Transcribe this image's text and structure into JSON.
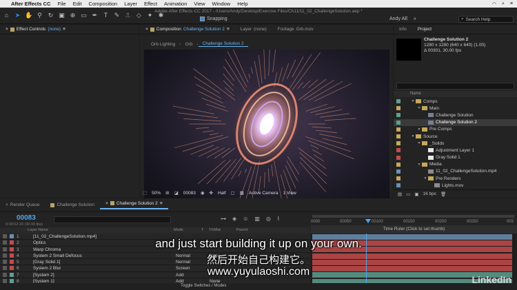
{
  "menubar": {
    "app": "After Effects CC",
    "items": [
      "File",
      "Edit",
      "Composition",
      "Layer",
      "Effect",
      "Animation",
      "View",
      "Window",
      "Help"
    ]
  },
  "toolbar": {
    "title": "Adobe After Effects CC 2017 - /Users/Andy/Desktop/Exercise Files/Ch11/11_02_ChallengeSolution.aep *",
    "snapping": "Snapping",
    "workspace_user": "Andy AE",
    "search_placeholder": "Search Help"
  },
  "effect_panel": {
    "tab_label": "Effect Controls",
    "tab_value": "(none)"
  },
  "comp_panel": {
    "tabs": [
      {
        "label": "Composition",
        "value": "Challenge Solution 2"
      },
      {
        "label": "Layer",
        "value": "(none)"
      },
      {
        "label": "Footage",
        "value": "Orb.mov"
      }
    ],
    "breadcrumbs": [
      "Orb Lighting",
      "Orb",
      "Challenge Solution 2"
    ],
    "viewer_bar": {
      "zoom": "50%",
      "timecode": "00083",
      "resolution": "Half",
      "camera": "Active Camera",
      "views": "1 View"
    }
  },
  "project_panel": {
    "tabs": [
      "Info",
      "Project"
    ],
    "selected_name": "Challenge Solution 2",
    "selected_dims": "1280 x 1280  (640 x 640) (1.00)",
    "selected_duration": "Δ 00301, 30.00 fps",
    "col_name": "Name",
    "items": [
      {
        "name": "Comps",
        "type": "folder",
        "depth": 0,
        "label": "#5f9e8f"
      },
      {
        "name": "Main",
        "type": "folder",
        "depth": 1,
        "label": "#c5a75d"
      },
      {
        "name": "Challenge Solution",
        "type": "comp",
        "depth": 2,
        "label": "#5f9e8f"
      },
      {
        "name": "Challenge Solution 2",
        "type": "comp",
        "depth": 2,
        "label": "#5f9e8f",
        "selected": true
      },
      {
        "name": "Pre Comps",
        "type": "folder",
        "depth": 1,
        "label": "#c5a75d"
      },
      {
        "name": "Source",
        "type": "folder",
        "depth": 0,
        "label": "#c5a75d"
      },
      {
        "name": "_Solids",
        "type": "folder",
        "depth": 1,
        "label": "#c5a75d"
      },
      {
        "name": "Adjustment Layer 1",
        "type": "solid",
        "depth": 2,
        "label": "#c44b4b"
      },
      {
        "name": "Gray Solid 1",
        "type": "solid",
        "depth": 2,
        "label": "#c44b4b"
      },
      {
        "name": "Media",
        "type": "folder",
        "depth": 1,
        "label": "#c5a75d"
      },
      {
        "name": "11_02_ChallengeSolution.mp4",
        "type": "footage",
        "depth": 2,
        "label": "#6a8fb5"
      },
      {
        "name": "Pre Renders",
        "type": "folder",
        "depth": 2,
        "label": "#c5a75d"
      },
      {
        "name": "Lights.mov",
        "type": "footage",
        "depth": 3,
        "label": "#6a8fb5"
      }
    ],
    "bpc": "16 bpc"
  },
  "timeline": {
    "tabs": [
      "Render Queue",
      "Challenge Solution",
      "Challenge Solution 2"
    ],
    "timecode": "00083",
    "timecode_sub": "0:00:02:23 (30.00 fps)",
    "col_layer_name": "Layer Name",
    "col_mode": "Mode",
    "col_t": "T",
    "col_trkmat": "TrkMat",
    "col_parent": "Parent",
    "ruler_ticks": [
      "0000",
      "00050",
      "00100",
      "00150",
      "00200",
      "00250",
      "003"
    ],
    "ruler_tooltip": "Time Ruler (Click to set thumb)",
    "toggle_label": "Toggle Switches / Modes",
    "layers": [
      {
        "num": "1",
        "name": "[11_02_ChallengeSolution.mp4]",
        "mode": "",
        "trk": "",
        "label": "#6a8fb5"
      },
      {
        "num": "2",
        "name": "Optics",
        "mode": "",
        "trk": "",
        "label": "#c44b4b"
      },
      {
        "num": "3",
        "name": "Warp Chroma",
        "mode": "",
        "trk": "",
        "label": "#c44b4b"
      },
      {
        "num": "4",
        "name": "System 2 Small Defocus",
        "mode": "Normal",
        "trk": "None",
        "label": "#c44b4b"
      },
      {
        "num": "5",
        "name": "[Gray Solid 1]",
        "mode": "Normal",
        "trk": "",
        "label": "#c44b4b"
      },
      {
        "num": "6",
        "name": "System 2 Blur",
        "mode": "Screen",
        "trk": "",
        "label": "#c44b4b"
      },
      {
        "num": "7",
        "name": "[System 2]",
        "mode": "Add",
        "trk": "",
        "label": "#5f9e8f"
      },
      {
        "num": "8",
        "name": "[System 1]",
        "mode": "Add",
        "trk": "None",
        "label": "#5f9e8f"
      }
    ]
  },
  "subtitles": {
    "en": "and just start building it up on your own.",
    "cn": "然后开始自己构建它。",
    "url": "www.yuyulaoshi.com"
  },
  "watermark": "LinkedIn"
}
